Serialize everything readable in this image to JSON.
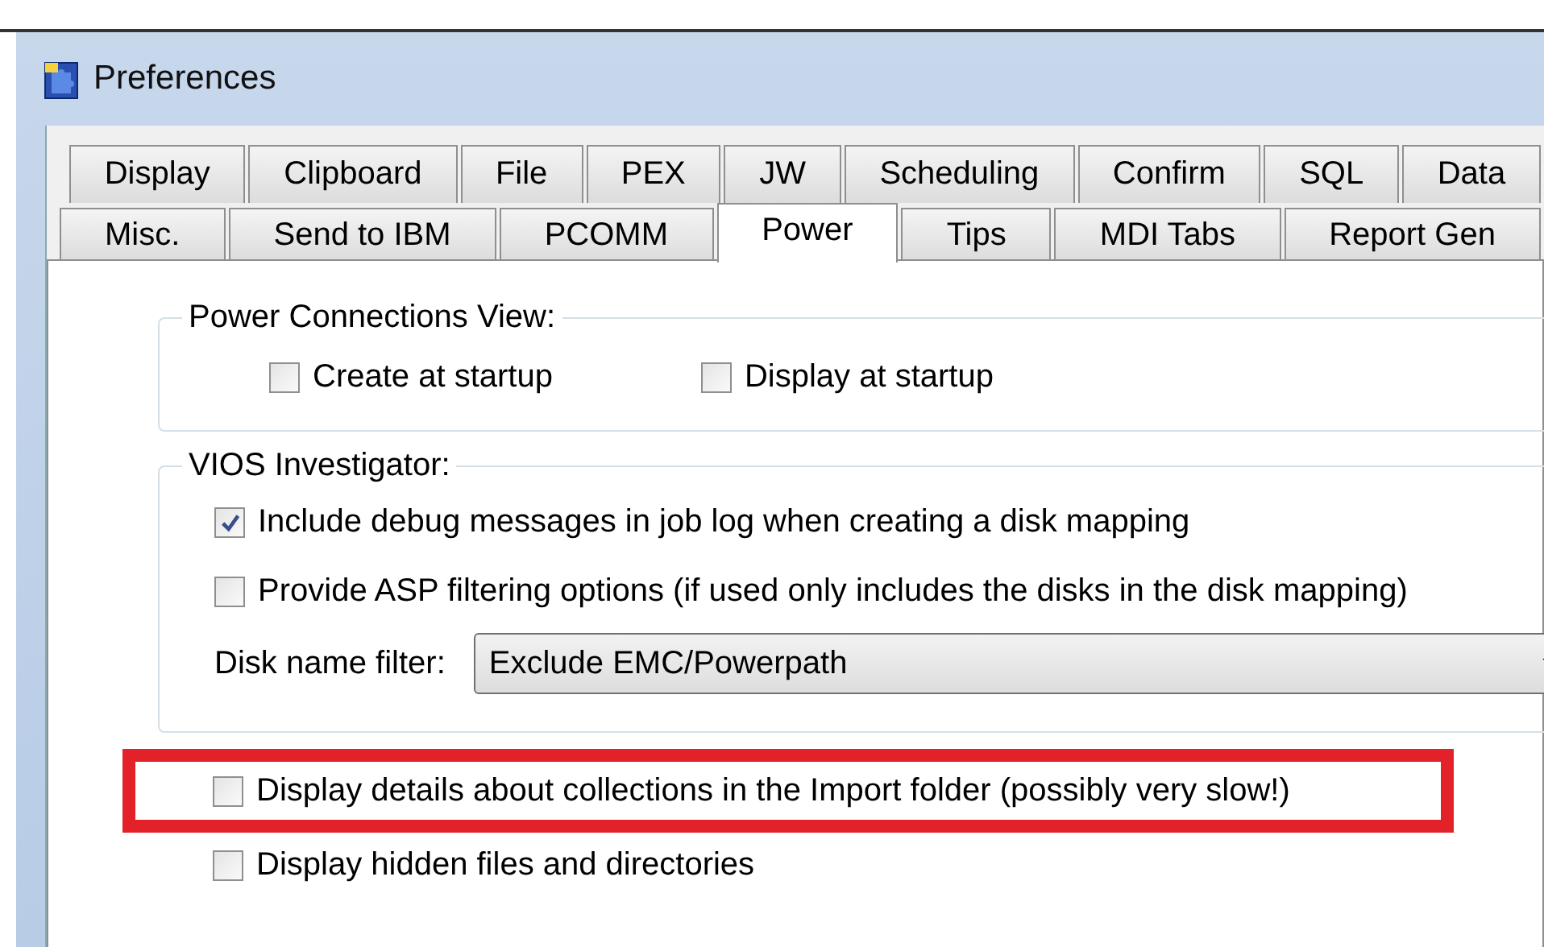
{
  "window": {
    "title": "Preferences"
  },
  "tab_rows": [
    [
      {
        "label": "Display",
        "selected": false
      },
      {
        "label": "Clipboard",
        "selected": false
      },
      {
        "label": "File",
        "selected": false
      },
      {
        "label": "PEX",
        "selected": false
      },
      {
        "label": "JW",
        "selected": false
      },
      {
        "label": "Scheduling",
        "selected": false
      },
      {
        "label": "Confirm",
        "selected": false
      },
      {
        "label": "SQL",
        "selected": false
      },
      {
        "label": "Data",
        "selected": false
      }
    ],
    [
      {
        "label": "Misc.",
        "selected": false
      },
      {
        "label": "Send to IBM",
        "selected": false
      },
      {
        "label": "PCOMM",
        "selected": false
      },
      {
        "label": "Power",
        "selected": true
      },
      {
        "label": "Tips",
        "selected": false
      },
      {
        "label": "MDI Tabs",
        "selected": false
      },
      {
        "label": "Report Gen",
        "selected": false
      }
    ]
  ],
  "power_connections_view": {
    "title": "Power Connections View:",
    "options": [
      {
        "label": "Create at startup",
        "checked": false
      },
      {
        "label": "Display at startup",
        "checked": false
      }
    ]
  },
  "vios_investigator": {
    "title": "VIOS Investigator:",
    "options": [
      {
        "label": "Include debug messages in job log when creating a disk mapping",
        "checked": true
      },
      {
        "label": "Provide ASP filtering options (if used only includes the disks in the disk mapping)",
        "checked": false
      }
    ],
    "disk_name_filter": {
      "label": "Disk name filter:",
      "value": "Exclude EMC/Powerpath"
    }
  },
  "options": [
    {
      "label": "Display details about collections in the Import folder (possibly very slow!)",
      "checked": false,
      "highlighted": true
    },
    {
      "label": "Display hidden files and directories",
      "checked": false,
      "highlighted": false
    }
  ]
}
